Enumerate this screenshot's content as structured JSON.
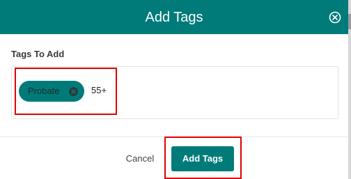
{
  "dialog": {
    "title": "Add Tags",
    "close_icon": "close-circle-icon"
  },
  "tags_section": {
    "label": "Tags To Add",
    "tags": [
      {
        "label": "Probate",
        "remove_icon": "remove-circle-icon"
      }
    ],
    "extra_count": "55+"
  },
  "footer": {
    "cancel_label": "Cancel",
    "add_label": "Add Tags"
  },
  "colors": {
    "accent": "#007b7a",
    "highlight": "#e00000"
  }
}
